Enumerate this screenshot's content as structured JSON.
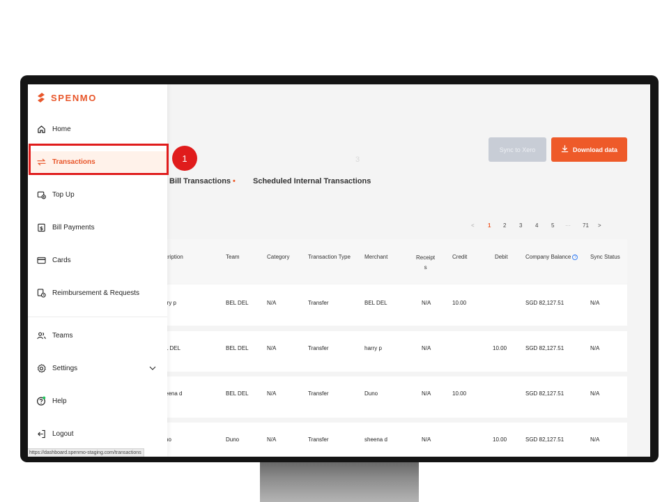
{
  "brand": {
    "name": "SPENMO",
    "accent": "#ee5a29"
  },
  "sidebar": {
    "items": [
      {
        "label": "Home",
        "icon": "home-icon"
      },
      {
        "label": "Transactions",
        "icon": "swap-arrows-icon",
        "active": true
      },
      {
        "label": "Top Up",
        "icon": "wallet-topup-icon"
      },
      {
        "label": "Bill Payments",
        "icon": "bill-dollar-icon"
      },
      {
        "label": "Cards",
        "icon": "card-icon"
      },
      {
        "label": "Reimbursement & Requests",
        "icon": "receipt-clock-icon"
      },
      {
        "label": "Teams",
        "icon": "people-icon"
      },
      {
        "label": "Settings",
        "icon": "gear-icon"
      },
      {
        "label": "Help",
        "icon": "help-icon"
      },
      {
        "label": "Logout",
        "icon": "logout-icon"
      }
    ],
    "status_url": "https://dashboard.spenmo-staging.com/transactions"
  },
  "step_marker": "1",
  "faint_text": "3",
  "actions": {
    "sync_label": "Sync to Xero",
    "download_label": "Download data"
  },
  "tabs": [
    {
      "label": "Bill Transactions",
      "dot": "•"
    },
    {
      "label": "Scheduled Internal Transactions"
    }
  ],
  "pagination": {
    "prev": "<",
    "pages": [
      "1",
      "2",
      "3",
      "4",
      "5"
    ],
    "ellipsis": "···",
    "last": "71",
    "next": ">",
    "current": "1"
  },
  "table": {
    "columns": [
      "scription",
      "Team",
      "Category",
      "Transaction Type",
      "Merchant",
      "Receipt\ns",
      "Credit",
      "Debit",
      "Company Balance",
      "Sync Status"
    ],
    "rows": [
      [
        "rry p",
        "BEL DEL",
        "N/A",
        "Transfer",
        "BEL DEL",
        "N/A",
        "10.00",
        "",
        "SGD 82,127.51",
        "N/A"
      ],
      [
        "L DEL",
        "BEL DEL",
        "N/A",
        "Transfer",
        "harry p",
        "N/A",
        "",
        "10.00",
        "SGD 82,127.51",
        "N/A"
      ],
      [
        "eena d",
        "BEL DEL",
        "N/A",
        "Transfer",
        "Duno",
        "N/A",
        "10.00",
        "",
        "SGD 82,127.51",
        "N/A"
      ],
      [
        "no",
        "Duno",
        "N/A",
        "Transfer",
        "sheena d",
        "N/A",
        "",
        "10.00",
        "SGD 82,127.51",
        "N/A"
      ]
    ]
  }
}
